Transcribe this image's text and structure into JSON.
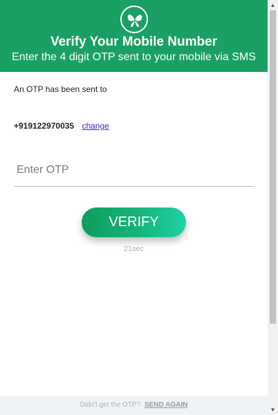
{
  "header": {
    "logo_icon": "butterfly-icon",
    "title": "Verify Your Mobile Number",
    "subtitle": "Enter the 4 digit OTP sent to your mobile via SMS"
  },
  "body": {
    "sent_label": "An OTP has been sent to",
    "phone_number": "+919122970035",
    "change_label": "change",
    "otp_placeholder": "Enter OTP",
    "otp_value": "",
    "verify_label": "VERIFY",
    "timer": "21sec"
  },
  "footer": {
    "prompt": "Didn't get the OTP?",
    "send_again_label": "SEND AGAIN"
  },
  "colors": {
    "header_bg": "#1aa063",
    "button_gradient_start": "#0e9c5e",
    "button_gradient_end": "#1fd2a6",
    "link": "#4b1ac2",
    "footer_bg": "#eef4f6"
  }
}
